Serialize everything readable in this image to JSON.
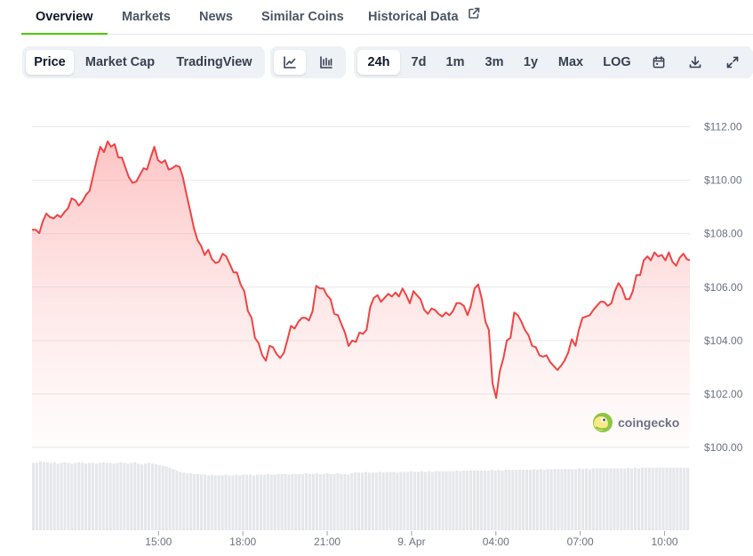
{
  "tabs": [
    {
      "label": "Overview",
      "active": true
    },
    {
      "label": "Markets",
      "active": false
    },
    {
      "label": "News",
      "active": false
    },
    {
      "label": "Similar Coins",
      "active": false
    },
    {
      "label": "Historical Data",
      "active": false,
      "external_icon": "external-link-icon"
    }
  ],
  "view_modes": [
    {
      "label": "Price",
      "active": true
    },
    {
      "label": "Market Cap",
      "active": false
    },
    {
      "label": "TradingView",
      "active": false
    }
  ],
  "chart_styles": [
    {
      "icon": "line-chart-icon",
      "active": true
    },
    {
      "icon": "candlestick-chart-icon",
      "active": false
    }
  ],
  "ranges": [
    {
      "label": "24h",
      "active": true
    },
    {
      "label": "7d",
      "active": false
    },
    {
      "label": "1m",
      "active": false
    },
    {
      "label": "3m",
      "active": false
    },
    {
      "label": "1y",
      "active": false
    },
    {
      "label": "Max",
      "active": false
    },
    {
      "label": "LOG",
      "active": false
    }
  ],
  "tool_icons": [
    "calendar-icon",
    "download-icon",
    "fullscreen-icon"
  ],
  "watermark": {
    "text": "coingecko",
    "icon": "coingecko-logo-icon"
  },
  "colors": {
    "line": "#ef4444",
    "fill": "#fecaca",
    "accent": "#4bcc00",
    "volume": "#e5e7eb",
    "grid": "#e5e7eb"
  },
  "chart_data": {
    "type": "area",
    "title": "",
    "xlabel": "",
    "ylabel": "",
    "y_tick_labels": [
      "$112.00",
      "$110.00",
      "$108.00",
      "$106.00",
      "$104.00",
      "$102.00",
      "$100.00"
    ],
    "y_ticks": [
      112,
      110,
      108,
      106,
      104,
      102,
      100
    ],
    "ylim": [
      100,
      112.15
    ],
    "x_tick_labels": [
      "15:00",
      "18:00",
      "21:00",
      "9. Apr",
      "04:00",
      "07:00",
      "10:00"
    ],
    "x_ticks": [
      4.5,
      7.5,
      10.5,
      13.5,
      16.5,
      19.5,
      22.5
    ],
    "xlim": [
      0,
      23.4
    ],
    "grid": true,
    "series": [
      {
        "values": [
          [
            0.0,
            108.15
          ],
          [
            0.13,
            108.15
          ],
          [
            0.26,
            108.02
          ],
          [
            0.38,
            108.45
          ],
          [
            0.51,
            108.75
          ],
          [
            0.64,
            108.62
          ],
          [
            0.77,
            108.57
          ],
          [
            0.9,
            108.7
          ],
          [
            1.02,
            108.62
          ],
          [
            1.15,
            108.8
          ],
          [
            1.28,
            108.95
          ],
          [
            1.41,
            109.32
          ],
          [
            1.54,
            109.25
          ],
          [
            1.66,
            109.05
          ],
          [
            1.79,
            109.2
          ],
          [
            1.92,
            109.45
          ],
          [
            2.05,
            109.6
          ],
          [
            2.17,
            110.15
          ],
          [
            2.3,
            110.75
          ],
          [
            2.43,
            111.25
          ],
          [
            2.56,
            111.05
          ],
          [
            2.69,
            111.45
          ],
          [
            2.81,
            111.25
          ],
          [
            2.94,
            111.35
          ],
          [
            3.07,
            110.85
          ],
          [
            3.2,
            110.85
          ],
          [
            3.33,
            110.45
          ],
          [
            3.45,
            110.1
          ],
          [
            3.58,
            109.9
          ],
          [
            3.71,
            109.95
          ],
          [
            3.84,
            110.2
          ],
          [
            3.97,
            110.45
          ],
          [
            4.09,
            110.4
          ],
          [
            4.22,
            110.85
          ],
          [
            4.35,
            111.25
          ],
          [
            4.48,
            110.75
          ],
          [
            4.61,
            110.65
          ],
          [
            4.73,
            110.75
          ],
          [
            4.86,
            110.4
          ],
          [
            4.99,
            110.45
          ],
          [
            5.12,
            110.55
          ],
          [
            5.25,
            110.5
          ],
          [
            5.37,
            110.1
          ],
          [
            5.5,
            109.45
          ],
          [
            5.63,
            108.85
          ],
          [
            5.76,
            108.2
          ],
          [
            5.89,
            107.75
          ],
          [
            6.01,
            107.55
          ],
          [
            6.14,
            107.2
          ],
          [
            6.27,
            107.4
          ],
          [
            6.4,
            107.05
          ],
          [
            6.53,
            106.9
          ],
          [
            6.65,
            106.95
          ],
          [
            6.78,
            107.25
          ],
          [
            6.91,
            107.15
          ],
          [
            7.04,
            106.85
          ],
          [
            7.17,
            106.55
          ],
          [
            7.29,
            106.55
          ],
          [
            7.42,
            106.1
          ],
          [
            7.55,
            105.85
          ],
          [
            7.68,
            105.1
          ],
          [
            7.81,
            104.85
          ],
          [
            7.93,
            104.1
          ],
          [
            8.06,
            103.9
          ],
          [
            8.19,
            103.45
          ],
          [
            8.32,
            103.25
          ],
          [
            8.45,
            103.8
          ],
          [
            8.57,
            103.75
          ],
          [
            8.7,
            103.5
          ],
          [
            8.83,
            103.35
          ],
          [
            8.96,
            103.55
          ],
          [
            9.09,
            104.05
          ],
          [
            9.21,
            104.55
          ],
          [
            9.34,
            104.45
          ],
          [
            9.47,
            104.7
          ],
          [
            9.6,
            104.85
          ],
          [
            9.73,
            104.85
          ],
          [
            9.85,
            104.75
          ],
          [
            9.98,
            105.1
          ],
          [
            10.11,
            106.05
          ],
          [
            10.24,
            105.95
          ],
          [
            10.37,
            105.95
          ],
          [
            10.49,
            105.7
          ],
          [
            10.62,
            105.55
          ],
          [
            10.75,
            105.0
          ],
          [
            10.88,
            104.95
          ],
          [
            11.01,
            104.6
          ],
          [
            11.13,
            104.3
          ],
          [
            11.26,
            103.8
          ],
          [
            11.39,
            104.0
          ],
          [
            11.52,
            103.95
          ],
          [
            11.65,
            104.3
          ],
          [
            11.77,
            104.25
          ],
          [
            11.9,
            104.4
          ],
          [
            12.03,
            105.25
          ],
          [
            12.16,
            105.6
          ],
          [
            12.29,
            105.7
          ],
          [
            12.41,
            105.45
          ],
          [
            12.54,
            105.6
          ],
          [
            12.67,
            105.75
          ],
          [
            12.8,
            105.65
          ],
          [
            12.93,
            105.8
          ],
          [
            13.05,
            105.65
          ],
          [
            13.18,
            105.95
          ],
          [
            13.31,
            105.7
          ],
          [
            13.44,
            105.4
          ],
          [
            13.57,
            105.85
          ],
          [
            13.69,
            105.7
          ],
          [
            13.82,
            105.55
          ],
          [
            13.95,
            105.15
          ],
          [
            14.08,
            105.0
          ],
          [
            14.21,
            105.2
          ],
          [
            14.33,
            105.15
          ],
          [
            14.46,
            105.0
          ],
          [
            14.59,
            104.9
          ],
          [
            14.72,
            105.05
          ],
          [
            14.85,
            104.95
          ],
          [
            14.97,
            105.1
          ],
          [
            15.1,
            105.4
          ],
          [
            15.23,
            105.4
          ],
          [
            15.36,
            105.3
          ],
          [
            15.49,
            104.95
          ],
          [
            15.61,
            105.3
          ],
          [
            15.74,
            105.95
          ],
          [
            15.87,
            106.1
          ],
          [
            16.0,
            105.55
          ],
          [
            16.13,
            104.7
          ],
          [
            16.25,
            104.4
          ],
          [
            16.38,
            102.4
          ],
          [
            16.51,
            101.85
          ],
          [
            16.64,
            102.85
          ],
          [
            16.77,
            103.35
          ],
          [
            16.89,
            104.0
          ],
          [
            17.02,
            104.1
          ],
          [
            17.15,
            105.05
          ],
          [
            17.28,
            104.95
          ],
          [
            17.41,
            104.7
          ],
          [
            17.53,
            104.4
          ],
          [
            17.66,
            104.2
          ],
          [
            17.79,
            103.8
          ],
          [
            17.92,
            103.75
          ],
          [
            18.05,
            103.45
          ],
          [
            18.17,
            103.4
          ],
          [
            18.3,
            103.45
          ],
          [
            18.43,
            103.2
          ],
          [
            18.56,
            103.05
          ],
          [
            18.69,
            102.9
          ],
          [
            18.81,
            103.05
          ],
          [
            18.94,
            103.25
          ],
          [
            19.07,
            103.55
          ],
          [
            19.2,
            104.05
          ],
          [
            19.33,
            103.8
          ],
          [
            19.45,
            104.4
          ],
          [
            19.58,
            104.85
          ],
          [
            19.71,
            104.9
          ],
          [
            19.84,
            104.95
          ],
          [
            19.97,
            105.15
          ],
          [
            20.09,
            105.3
          ],
          [
            20.22,
            105.45
          ],
          [
            20.35,
            105.45
          ],
          [
            20.48,
            105.3
          ],
          [
            20.61,
            105.4
          ],
          [
            20.73,
            105.85
          ],
          [
            20.86,
            106.15
          ],
          [
            20.99,
            105.95
          ],
          [
            21.12,
            105.55
          ],
          [
            21.25,
            105.55
          ],
          [
            21.37,
            105.85
          ],
          [
            21.5,
            106.45
          ],
          [
            21.63,
            106.45
          ],
          [
            21.76,
            107.0
          ],
          [
            21.89,
            107.15
          ],
          [
            22.01,
            107.0
          ],
          [
            22.14,
            107.3
          ],
          [
            22.27,
            107.15
          ],
          [
            22.4,
            107.2
          ],
          [
            22.53,
            107.0
          ],
          [
            22.65,
            107.3
          ],
          [
            22.78,
            106.95
          ],
          [
            22.91,
            106.8
          ],
          [
            23.04,
            107.1
          ],
          [
            23.17,
            107.25
          ],
          [
            23.29,
            107.05
          ],
          [
            23.4,
            107.0
          ]
        ]
      }
    ],
    "volume": {
      "ylim": [
        0,
        1
      ],
      "values": [
        0.97,
        0.97,
        0.99,
        0.98,
        0.98,
        0.97,
        0.98,
        0.96,
        0.97,
        0.98,
        0.97,
        0.96,
        0.97,
        0.98,
        0.97,
        0.96,
        0.97,
        0.97,
        0.96,
        0.97,
        0.98,
        0.97,
        0.97,
        0.96,
        0.97,
        0.98,
        0.97,
        0.96,
        0.97,
        0.98,
        0.96,
        0.95,
        0.96,
        0.97,
        0.96,
        0.95,
        0.94,
        0.93,
        0.92,
        0.9,
        0.88,
        0.86,
        0.84,
        0.83,
        0.82,
        0.82,
        0.81,
        0.81,
        0.8,
        0.8,
        0.79,
        0.8,
        0.79,
        0.79,
        0.79,
        0.8,
        0.79,
        0.79,
        0.8,
        0.79,
        0.8,
        0.8,
        0.8,
        0.79,
        0.8,
        0.8,
        0.8,
        0.81,
        0.8,
        0.8,
        0.81,
        0.81,
        0.81,
        0.8,
        0.81,
        0.81,
        0.81,
        0.81,
        0.82,
        0.81,
        0.81,
        0.82,
        0.81,
        0.81,
        0.82,
        0.81,
        0.81,
        0.82,
        0.81,
        0.81,
        0.8,
        0.82,
        0.83,
        0.83,
        0.83,
        0.84,
        0.83,
        0.83,
        0.83,
        0.84,
        0.83,
        0.84,
        0.84,
        0.84,
        0.83,
        0.84,
        0.84,
        0.84,
        0.85,
        0.84,
        0.84,
        0.85,
        0.84,
        0.85,
        0.84,
        0.85,
        0.85,
        0.85,
        0.85,
        0.85,
        0.85,
        0.86,
        0.85,
        0.86,
        0.86,
        0.86,
        0.86,
        0.86,
        0.86,
        0.86,
        0.86,
        0.87,
        0.86,
        0.87,
        0.86,
        0.87,
        0.87,
        0.87,
        0.87,
        0.87,
        0.87,
        0.87,
        0.87,
        0.88,
        0.87,
        0.88,
        0.87,
        0.88,
        0.88,
        0.88,
        0.88,
        0.88,
        0.88,
        0.88,
        0.88,
        0.88,
        0.89,
        0.88,
        0.89,
        0.88,
        0.89,
        0.89,
        0.89,
        0.89,
        0.89,
        0.89,
        0.89,
        0.89,
        0.89,
        0.89,
        0.9,
        0.89,
        0.9,
        0.89,
        0.9,
        0.9,
        0.9,
        0.9,
        0.9,
        0.9,
        0.9,
        0.9,
        0.9,
        0.9,
        0.9,
        0.9,
        0.9,
        0.9
      ]
    }
  }
}
